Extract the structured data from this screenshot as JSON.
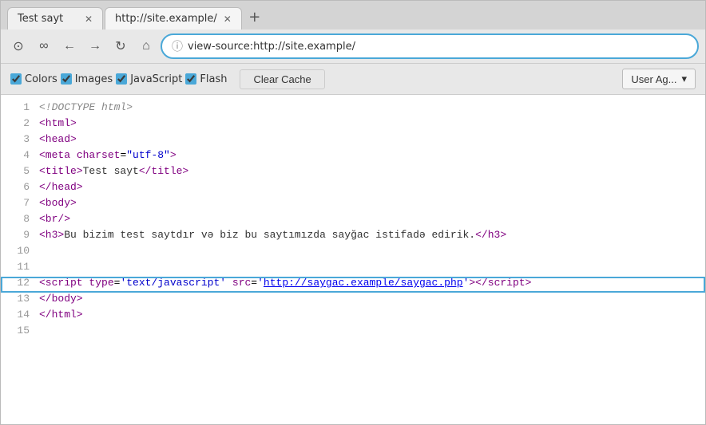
{
  "tabs": [
    {
      "id": "tab-1",
      "label": "Test sayt",
      "active": false
    },
    {
      "id": "tab-2",
      "label": "http://site.example/",
      "active": true
    }
  ],
  "new_tab_icon": "+",
  "nav": {
    "reload_icon": "↺",
    "home_icon": "⌂",
    "back_icon": "←",
    "forward_icon": "→",
    "history_icon": "⊙",
    "infinity_icon": "∞",
    "address": "view-source:http://site.example/",
    "info_icon": "ⓘ"
  },
  "toolbar": {
    "checkboxes": [
      {
        "id": "cb-colors",
        "label": "Colors",
        "checked": true
      },
      {
        "id": "cb-images",
        "label": "Images",
        "checked": true
      },
      {
        "id": "cb-javascript",
        "label": "JavaScript",
        "checked": true
      },
      {
        "id": "cb-flash",
        "label": "Flash",
        "checked": true
      }
    ],
    "clear_cache_label": "Clear Cache",
    "user_agent_label": "User Ag...",
    "dropdown_icon": "▾"
  },
  "source": {
    "lines": [
      {
        "num": 1,
        "html": "<span class='c-doctype'>&lt;!DOCTYPE html&gt;</span>",
        "highlighted": false
      },
      {
        "num": 2,
        "html": "<span class='c-tag'>&lt;html&gt;</span>",
        "highlighted": false
      },
      {
        "num": 3,
        "html": "<span class='c-tag'>&lt;head&gt;</span>",
        "highlighted": false
      },
      {
        "num": 4,
        "html": "<span class='c-tag'>&lt;meta</span> <span class='c-attr-name'>charset</span>=<span class='c-string'>\"utf-8\"</span><span class='c-tag'>&gt;</span>",
        "highlighted": false
      },
      {
        "num": 5,
        "html": "<span class='c-tag'>&lt;title&gt;</span><span class='c-text'>Test sayt</span><span class='c-tag'>&lt;/title&gt;</span>",
        "highlighted": false
      },
      {
        "num": 6,
        "html": "<span class='c-tag'>&lt;/head&gt;</span>",
        "highlighted": false
      },
      {
        "num": 7,
        "html": "<span class='c-tag'>&lt;body&gt;</span>",
        "highlighted": false
      },
      {
        "num": 8,
        "html": "<span class='c-tag'>&lt;br/&gt;</span>",
        "highlighted": false
      },
      {
        "num": 9,
        "html": "<span class='c-tag'>&lt;h3&gt;</span><span class='c-text'>Bu bizim test saytdır və biz bu saytımızda sayğac istifadə edirik.</span><span class='c-tag'>&lt;/h3&gt;</span>",
        "highlighted": false
      },
      {
        "num": 10,
        "html": "",
        "highlighted": false
      },
      {
        "num": 11,
        "html": "",
        "highlighted": false
      },
      {
        "num": 12,
        "html": "<span class='c-tag'>&lt;script</span> <span class='c-attr-name'>type</span>=<span class='c-string'>'text/javascript'</span> <span class='c-attr-name'>src</span>=<span class='c-string'>'<a class='c-link' href='#'>http://saygac.example/saygac.php</a>'</span><span class='c-tag'>&gt;&lt;/script&gt;</span>",
        "highlighted": true
      },
      {
        "num": 13,
        "html": "<span class='c-tag'>&lt;/body&gt;</span>",
        "highlighted": false
      },
      {
        "num": 14,
        "html": "<span class='c-tag'>&lt;/html&gt;</span>",
        "highlighted": false
      },
      {
        "num": 15,
        "html": "",
        "highlighted": false
      }
    ]
  }
}
